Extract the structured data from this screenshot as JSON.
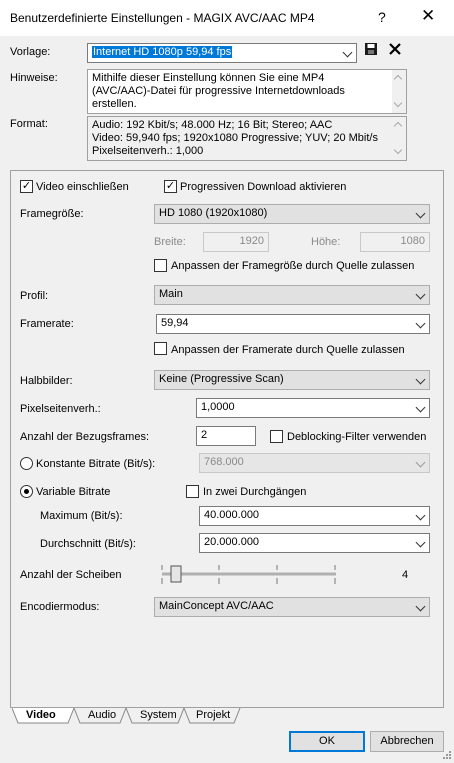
{
  "window": {
    "title": "Benutzerdefinierte Einstellungen - MAGIX AVC/AAC MP4",
    "help_glyph": "?",
    "close_glyph": "✕"
  },
  "template": {
    "label": "Vorlage:",
    "value": "Internet HD 1080p 59,94 fps"
  },
  "notes": {
    "label": "Hinweise:",
    "text": "Mithilfe dieser Einstellung können Sie eine MP4 (AVC/AAC)-Datei für progressive Internetdownloads erstellen."
  },
  "format": {
    "label": "Format:",
    "line1": "Audio: 192 Kbit/s; 48.000 Hz; 16 Bit; Stereo; AAC",
    "line2": "Video: 59,940 fps; 1920x1080 Progressive; YUV; 20 Mbit/s",
    "line3": "Pixelseitenverh.: 1,000"
  },
  "video": {
    "include_video": {
      "label": "Video einschließen",
      "checked": true
    },
    "progressive_download": {
      "label": "Progressiven Download aktivieren",
      "checked": true
    },
    "frame_size": {
      "label": "Framegröße:",
      "value": "HD 1080 (1920x1080)"
    },
    "width": {
      "label": "Breite:",
      "value": "1920"
    },
    "height": {
      "label": "Höhe:",
      "value": "1080"
    },
    "match_frame_size": {
      "label": "Anpassen der Framegröße durch Quelle zulassen",
      "checked": false
    },
    "profile": {
      "label": "Profil:",
      "value": "Main"
    },
    "frame_rate": {
      "label": "Framerate:",
      "value": "59,94"
    },
    "match_frame_rate": {
      "label": "Anpassen der Framerate durch Quelle zulassen",
      "checked": false
    },
    "fields": {
      "label": "Halbbilder:",
      "value": "Keine (Progressive Scan)"
    },
    "pixel_aspect": {
      "label": "Pixelseitenverh.:",
      "value": "1,0000"
    },
    "ref_frames": {
      "label": "Anzahl der Bezugsframes:",
      "value": "2"
    },
    "deblocking": {
      "label": "Deblocking-Filter verwenden",
      "checked": false
    },
    "constant_bitrate": {
      "label": "Konstante Bitrate (Bit/s):",
      "value": "768.000",
      "selected": false
    },
    "variable_bitrate": {
      "label": "Variable Bitrate",
      "selected": true
    },
    "two_pass": {
      "label": "In zwei Durchgängen",
      "checked": false
    },
    "maximum": {
      "label": "Maximum (Bit/s):",
      "value": "40.000.000"
    },
    "average": {
      "label": "Durchschnitt (Bit/s):",
      "value": "20.000.000"
    },
    "slices": {
      "label": "Anzahl der Scheiben",
      "value": "4"
    },
    "encode_mode": {
      "label": "Encodiermodus:",
      "value": "MainConcept AVC/AAC"
    }
  },
  "tabs": [
    {
      "label": "Video",
      "active": true
    },
    {
      "label": "Audio",
      "active": false
    },
    {
      "label": "System",
      "active": false
    },
    {
      "label": "Projekt",
      "active": false
    }
  ],
  "buttons": {
    "ok": "OK",
    "cancel": "Abbrechen"
  },
  "icons": {
    "save": "save-icon",
    "delete": "delete-icon"
  }
}
